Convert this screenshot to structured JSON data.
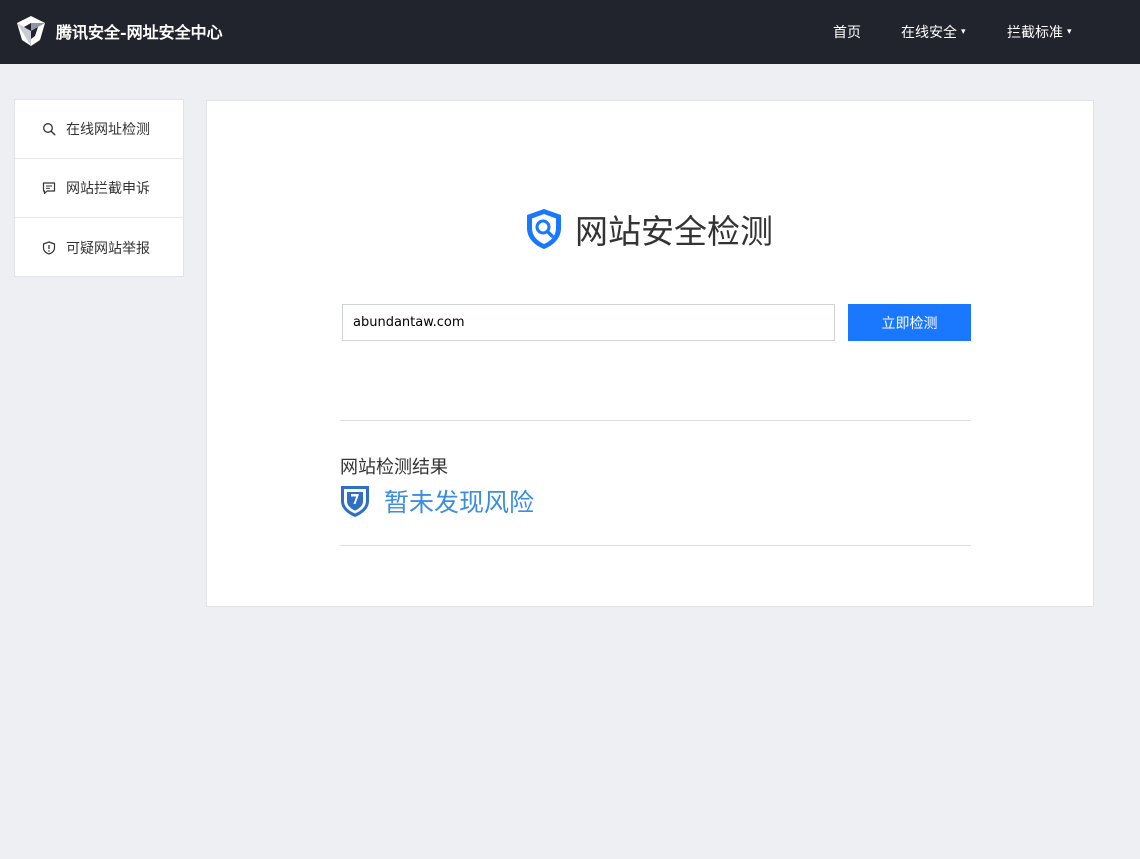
{
  "header": {
    "brand_title": "腾讯安全-网址安全中心",
    "nav": [
      {
        "label": "首页",
        "has_dropdown": false
      },
      {
        "label": "在线安全",
        "has_dropdown": true
      },
      {
        "label": "拦截标准",
        "has_dropdown": true
      }
    ],
    "caret": "▾"
  },
  "sidebar": {
    "items": [
      {
        "label": "在线网址检测",
        "icon": "search-icon"
      },
      {
        "label": "网站拦截申诉",
        "icon": "chat-icon"
      },
      {
        "label": "可疑网站举报",
        "icon": "shield-alert-icon"
      }
    ]
  },
  "main": {
    "title": "网站安全检测",
    "search": {
      "value": "abundantaw.com",
      "button_label": "立即检测"
    },
    "result": {
      "label": "网站检测结果",
      "status": "暂未发现风险"
    }
  },
  "colors": {
    "topbar": "#21232d",
    "accent": "#1a77ff",
    "result_text": "#3b8de0",
    "background": "#eeeff3"
  }
}
